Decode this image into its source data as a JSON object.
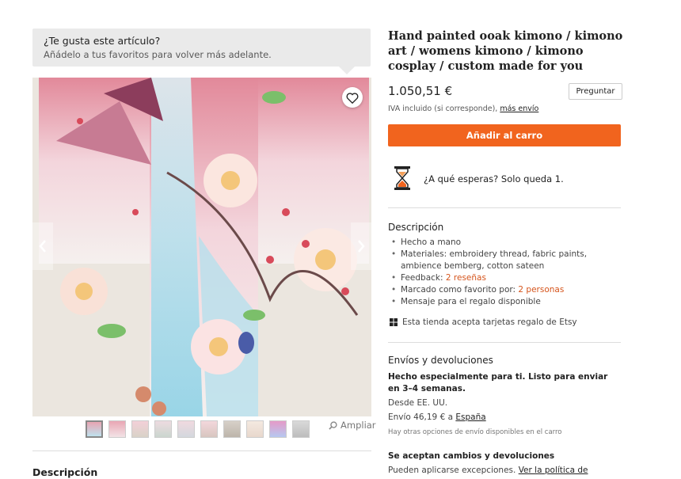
{
  "favorites_banner": {
    "title": "¿Te gusta este artículo?",
    "subtitle": "Añádelo a tus favoritos para volver más adelante."
  },
  "gallery": {
    "zoom_label": "Ampliar",
    "thumbnail_count": 10
  },
  "left_section": {
    "description_heading": "Descripción"
  },
  "product": {
    "title": "Hand painted ooak kimono / kimono art / womens kimono / kimono cosplay / custom made for you",
    "price": "1.050,51 €",
    "ask_button": "Preguntar",
    "tax_text": "IVA incluido (si corresponde), ",
    "tax_link": "más envío",
    "add_to_cart": "Añadir al carro",
    "stock_bold": "¿A qué esperas?",
    "stock_text": " Solo queda 1."
  },
  "description": {
    "heading": "Descripción",
    "handmade": "Hecho a mano",
    "materials": "Materiales: embroidery thread, fabric paints, ambience bemberg, cotton sateen",
    "feedback_label": "Feedback: ",
    "feedback_link": "2 reseñas",
    "favorited_label": "Marcado como favorito por: ",
    "favorited_link": "2 personas",
    "gift_message": "Mensaje para el regalo disponible",
    "gift_cards": "Esta tienda acepta tarjetas regalo de Etsy"
  },
  "shipping": {
    "heading": "Envíos y devoluciones",
    "made_to_order": "Hecho especialmente para ti. Listo para enviar en 3–4 semanas.",
    "from": "Desde EE. UU.",
    "cost_text": "Envío 46,19 € a ",
    "cost_link": "España",
    "other_options": "Hay otras opciones de envío disponibles en el carro",
    "returns_heading": "Se aceptan cambios y devoluciones",
    "exceptions_text": "Pueden aplicarse excepciones. ",
    "policy_link": "Ver la política de"
  },
  "colors": {
    "accent": "#f1641e",
    "link_orange": "#d5541b",
    "banner_bg": "#eaeaea"
  }
}
